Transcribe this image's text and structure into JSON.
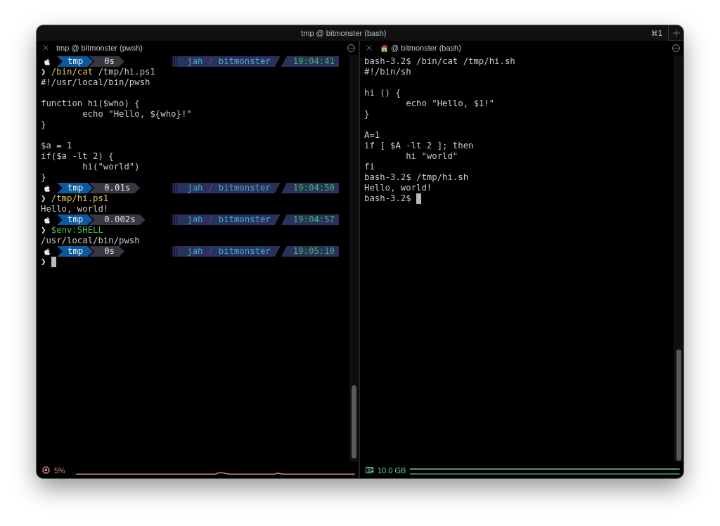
{
  "window": {
    "title": "tmp @ bitmonster (bash)",
    "shortcut": "⌘1"
  },
  "panes": [
    {
      "title": "tmp @ bitmonster (pwsh)",
      "shows_icon": false,
      "lines": [
        {
          "kind": "prompt",
          "directory": "tmp",
          "duration": "0s",
          "user": "jah",
          "separator": "/",
          "host": "bitmonster",
          "time": "19:04:41"
        },
        {
          "kind": "input",
          "symbol": "❯",
          "tokens": [
            {
              "text": "/bin/cat",
              "kind": "command"
            },
            {
              "text": "/tmp/hi.ps1",
              "kind": "argument"
            }
          ],
          "cursor": false
        },
        {
          "kind": "output",
          "text": "#!/usr/local/bin/pwsh"
        },
        {
          "kind": "blank"
        },
        {
          "kind": "output",
          "text": "function hi($who) {"
        },
        {
          "kind": "output",
          "text": "        echo \"Hello, ${who}!\""
        },
        {
          "kind": "output",
          "text": "}"
        },
        {
          "kind": "blank"
        },
        {
          "kind": "output",
          "text": "$a = 1"
        },
        {
          "kind": "output",
          "text": "if($a -lt 2) {"
        },
        {
          "kind": "output",
          "text": "        hi(\"world\")"
        },
        {
          "kind": "output",
          "text": "}"
        },
        {
          "kind": "prompt",
          "directory": "tmp",
          "duration": "0.01s",
          "user": "jah",
          "separator": "/",
          "host": "bitmonster",
          "time": "19:04:50"
        },
        {
          "kind": "input",
          "symbol": "❯",
          "tokens": [
            {
              "text": "/tmp/hi.ps1",
              "kind": "command"
            }
          ],
          "cursor": false
        },
        {
          "kind": "output",
          "text": "Hello, world!"
        },
        {
          "kind": "prompt",
          "directory": "tmp",
          "duration": "0.002s",
          "user": "jah",
          "separator": "/",
          "host": "bitmonster",
          "time": "19:04:57"
        },
        {
          "kind": "input",
          "symbol": "❯",
          "tokens": [
            {
              "text": "$env:SHELL",
              "kind": "variable"
            }
          ],
          "cursor": false
        },
        {
          "kind": "output",
          "text": "/usr/local/bin/pwsh"
        },
        {
          "kind": "prompt",
          "directory": "tmp",
          "duration": "0s",
          "user": "jah",
          "separator": "/",
          "host": "bitmonster",
          "time": "19:05:10"
        },
        {
          "kind": "input",
          "symbol": "❯",
          "cursor": true
        }
      ],
      "status": {
        "kind": "cpu",
        "value": "5%"
      }
    },
    {
      "title": "@ bitmonster (bash)",
      "shows_icon": true,
      "lines": [
        {
          "kind": "shell_input",
          "prompt": "bash-3.2$",
          "command": "/bin/cat /tmp/hi.sh",
          "cursor": false
        },
        {
          "kind": "output",
          "text": "#!/bin/sh"
        },
        {
          "kind": "blank"
        },
        {
          "kind": "output",
          "text": "hi () {"
        },
        {
          "kind": "output",
          "text": "        echo \"Hello, $1!\""
        },
        {
          "kind": "output",
          "text": "}"
        },
        {
          "kind": "blank"
        },
        {
          "kind": "output",
          "text": "A=1"
        },
        {
          "kind": "output",
          "text": "if [ $A -lt 2 ]; then"
        },
        {
          "kind": "output",
          "text": "        hi \"world\""
        },
        {
          "kind": "output",
          "text": "fi"
        },
        {
          "kind": "shell_input",
          "prompt": "bash-3.2$",
          "command": "/tmp/hi.sh",
          "cursor": false
        },
        {
          "kind": "output",
          "text": "Hello, world!"
        },
        {
          "kind": "shell_input",
          "prompt": "bash-3.2$",
          "cursor": true
        }
      ],
      "status": {
        "kind": "memory",
        "value": "10.0 GB"
      }
    }
  ]
}
